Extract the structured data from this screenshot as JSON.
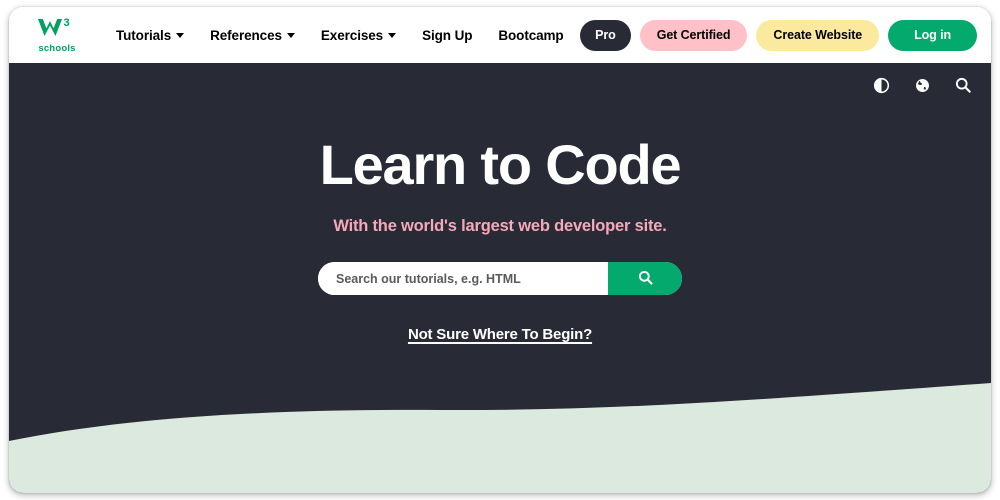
{
  "brand": {
    "logo_text": "W3",
    "logo_sub": "schools",
    "logo_color": "#00A060"
  },
  "nav": {
    "items": [
      {
        "label": "Tutorials",
        "has_dropdown": true,
        "name": "nav-tutorials"
      },
      {
        "label": "References",
        "has_dropdown": true,
        "name": "nav-references"
      },
      {
        "label": "Exercises",
        "has_dropdown": true,
        "name": "nav-exercises"
      },
      {
        "label": "Sign Up",
        "has_dropdown": false,
        "name": "nav-sign-up"
      },
      {
        "label": "Bootcamp",
        "has_dropdown": false,
        "name": "nav-bootcamp"
      }
    ]
  },
  "actions": {
    "pro": {
      "label": "Pro",
      "bg": "#282A35",
      "fg": "#FFFFFF"
    },
    "get_certified": {
      "label": "Get Certified",
      "bg": "#FFC0C7",
      "fg": "#000000"
    },
    "create_website": {
      "label": "Create Website",
      "bg": "#FBEA9E",
      "fg": "#000000"
    },
    "log_in": {
      "label": "Log in",
      "bg": "#04AA6D",
      "fg": "#FFFFFF"
    }
  },
  "hero_icons": [
    {
      "name": "contrast-toggle-icon",
      "icon": "contrast-icon"
    },
    {
      "name": "language-globe-icon",
      "icon": "globe-icon"
    },
    {
      "name": "search-toggle-icon",
      "icon": "search-icon"
    }
  ],
  "hero": {
    "title": "Learn to Code",
    "subtitle": "With the world's largest web developer site.",
    "title_color": "#FFFFFF",
    "subtitle_color": "#F6A8B8",
    "background": "#282A35",
    "search": {
      "placeholder": "Search our tutorials, e.g. HTML",
      "value": "",
      "button_icon": "search-icon",
      "button_color": "#04AA6D"
    },
    "begin_link": "Not Sure Where To Begin?"
  },
  "wave": {
    "color": "#DCE9DE"
  }
}
